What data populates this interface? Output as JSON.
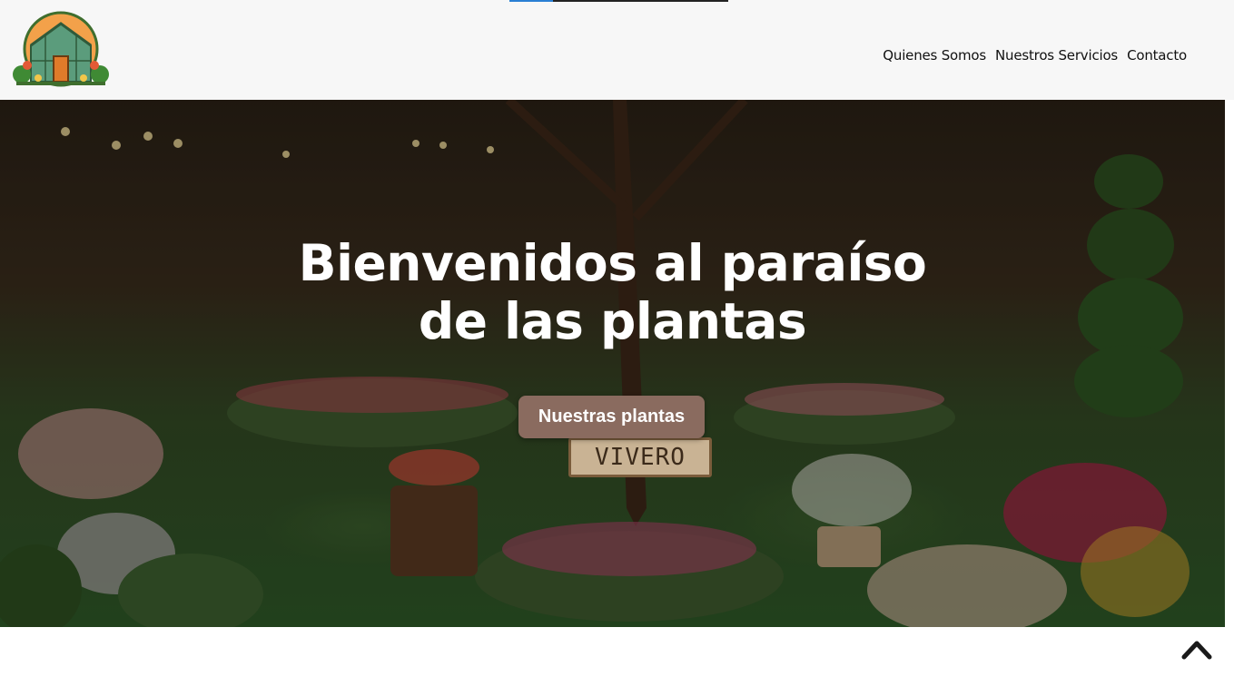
{
  "header": {
    "logo_icon": "greenhouse-logo",
    "progress": 0.2,
    "colors": {
      "background": "#f7f7f7",
      "progress_fill": "#2a7fd4",
      "progress_track": "#222222"
    }
  },
  "nav": {
    "items": [
      {
        "label": "Quienes Somos"
      },
      {
        "label": "Nuestros Servicios"
      },
      {
        "label": "Contacto"
      }
    ]
  },
  "hero": {
    "title_line1": "Bienvenidos al paraíso",
    "title_line2": "de las plantas",
    "button_label": "Nuestras plantas",
    "sign_text": "VIVERO",
    "colors": {
      "button": "#8a6b5f",
      "title": "#ffffff"
    }
  },
  "scroll_top": {
    "icon": "chevron-up-icon"
  }
}
